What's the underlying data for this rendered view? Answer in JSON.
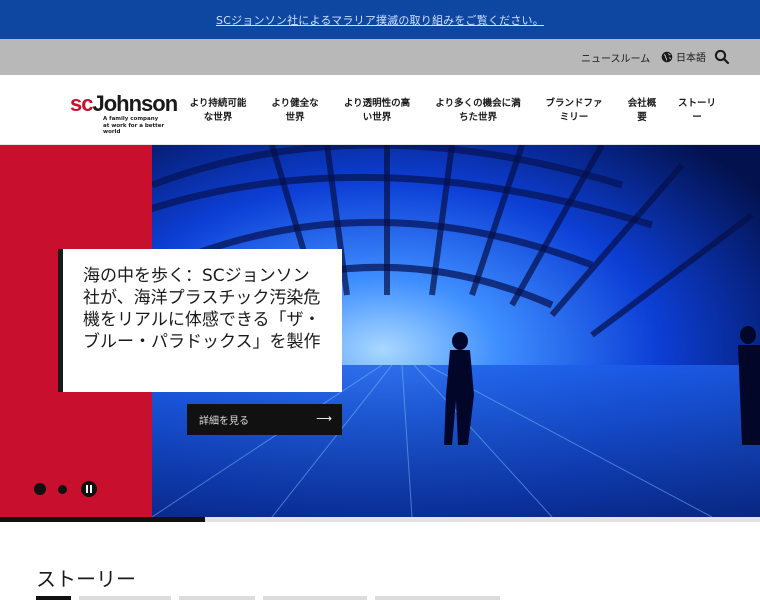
{
  "announcement": {
    "text": "SCジョンソン社によるマラリア撲滅の取り組みをご覧ください。"
  },
  "utility": {
    "newsroom": "ニュースルーム",
    "language": "日本語"
  },
  "brand": {
    "name_sc": "sc",
    "name_rest": "Johnson",
    "tagline_1": "A family company",
    "tagline_2": "at work for a better world"
  },
  "nav": [
    {
      "label": "より持続可能な世界"
    },
    {
      "label": "より健全な世界"
    },
    {
      "label": "より透明性の高い世界"
    },
    {
      "label": "より多くの機会に満ちた世界"
    },
    {
      "label": "ブランドファミリー"
    },
    {
      "label": "会社概要"
    },
    {
      "label": "ストーリー"
    }
  ],
  "hero": {
    "headline": "海の中を歩く：SCジョンソン社が、海洋プラスチック汚染危機をリアルに体感できる「ザ・ブルー・パラドックス」を製作",
    "cta": "詳細を見る",
    "slide_progress": 0.27
  },
  "stories": {
    "title": "ストーリー"
  },
  "colors": {
    "announcement_bg": "#0d47a1",
    "brand_red": "#c8102e",
    "utility_bg": "#b8b8b8"
  },
  "icons": {
    "globe": "globe-icon",
    "search": "search-icon",
    "arrow": "arrow-right-icon",
    "pause": "pause-icon"
  }
}
